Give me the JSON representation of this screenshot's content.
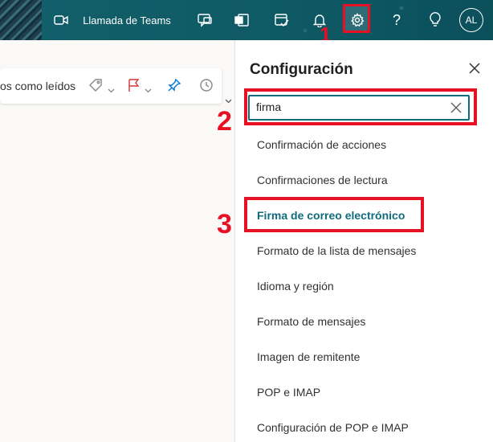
{
  "header": {
    "teams_call_label": "Llamada de Teams",
    "avatar_initials": "AL",
    "icons": [
      "video-icon",
      "chat-feedback-icon",
      "office-icon",
      "calendar-check-icon",
      "bell-icon",
      "gear-icon",
      "help-icon",
      "lightbulb-icon"
    ]
  },
  "toolbar": {
    "mark_read_label": "os como leídos"
  },
  "settings": {
    "title": "Configuración",
    "search_value": "firma",
    "results": [
      "Confirmación de acciones",
      "Confirmaciones de lectura",
      "Firma de correo electrónico",
      "Formato de la lista de mensajes",
      "Idioma y región",
      "Formato de mensajes",
      "Imagen de remitente",
      "POP e IMAP",
      "Configuración de POP e IMAP"
    ],
    "active_result": "Firma de correo electrónico"
  },
  "annotations": {
    "step1": "1",
    "step2": "2",
    "step3": "3"
  },
  "colors": {
    "header_bg": "#0f5c66",
    "accent": "#0f6c7c",
    "annotation_red": "#e81123"
  }
}
